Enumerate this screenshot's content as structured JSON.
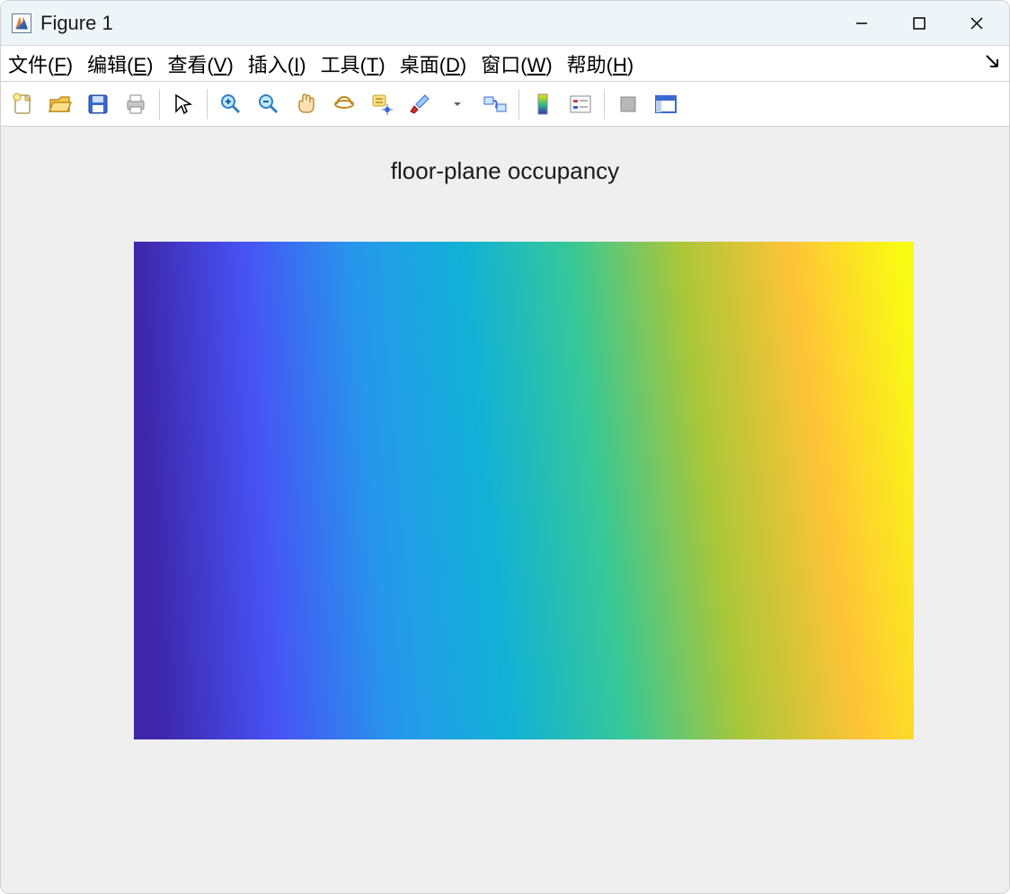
{
  "window": {
    "title": "Figure 1"
  },
  "menu": {
    "file": {
      "label": "文件(",
      "accel": "F",
      "tail": ")"
    },
    "edit": {
      "label": "编辑(",
      "accel": "E",
      "tail": ")"
    },
    "view": {
      "label": "查看(",
      "accel": "V",
      "tail": ")"
    },
    "insert": {
      "label": "插入(",
      "accel": "I",
      "tail": ")"
    },
    "tools": {
      "label": "工具(",
      "accel": "T",
      "tail": ")"
    },
    "desktop": {
      "label": "桌面(",
      "accel": "D",
      "tail": ")"
    },
    "window_m": {
      "label": "窗口(",
      "accel": "W",
      "tail": ")"
    },
    "help": {
      "label": "帮助(",
      "accel": "H",
      "tail": ")"
    }
  },
  "chart_data": {
    "type": "heatmap",
    "title": "floor-plane occupancy",
    "colormap": "parula",
    "xlabel": "",
    "ylabel": "",
    "xrange": [
      0,
      1
    ],
    "yrange": [
      0,
      1
    ],
    "description": "Smooth parula gradient mostly along x (low→high left→right); slight vertical component produces slanted contours: upper-left darkest blue (~0.0), upper-right bright yellow (~1.0), lower-right golden yellow (~0.95).",
    "value_samples": [
      {
        "ux": 0.0,
        "uy": 0.0,
        "v": 0.02
      },
      {
        "ux": 1.0,
        "uy": 0.0,
        "v": 1.0
      },
      {
        "ux": 0.0,
        "uy": 1.0,
        "v": 0.0
      },
      {
        "ux": 1.0,
        "uy": 1.0,
        "v": 0.95
      },
      {
        "ux": 0.5,
        "uy": 0.5,
        "v": 0.5
      }
    ],
    "parula_stops": [
      [
        0.2422,
        0.1504,
        0.6603
      ],
      [
        0.281,
        0.3228,
        0.9578
      ],
      [
        0.154,
        0.5902,
        0.9218
      ],
      [
        0.0689,
        0.6948,
        0.8394
      ],
      [
        0.2161,
        0.7843,
        0.5923
      ],
      [
        0.672,
        0.7793,
        0.2227
      ],
      [
        0.997,
        0.7659,
        0.2199
      ],
      [
        0.9769,
        0.9839,
        0.0805
      ]
    ]
  }
}
